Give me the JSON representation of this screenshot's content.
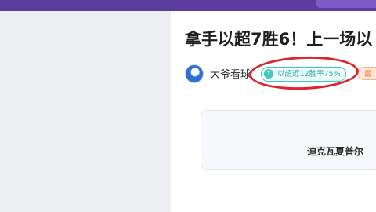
{
  "article": {
    "title": "拿手以超7胜6！上一场以",
    "author": "大爷看球",
    "badge_text": "以超近12胜率75%",
    "badge_icon": "↑",
    "orange_badge_text": "最"
  },
  "match": {
    "team_name": "迪克瓦夏普尔"
  },
  "colors": {
    "topbar": "#5a3d9e",
    "accent_teal": "#43c6b9",
    "annotation_red": "#d9252b",
    "orange": "#ff7a3d"
  }
}
